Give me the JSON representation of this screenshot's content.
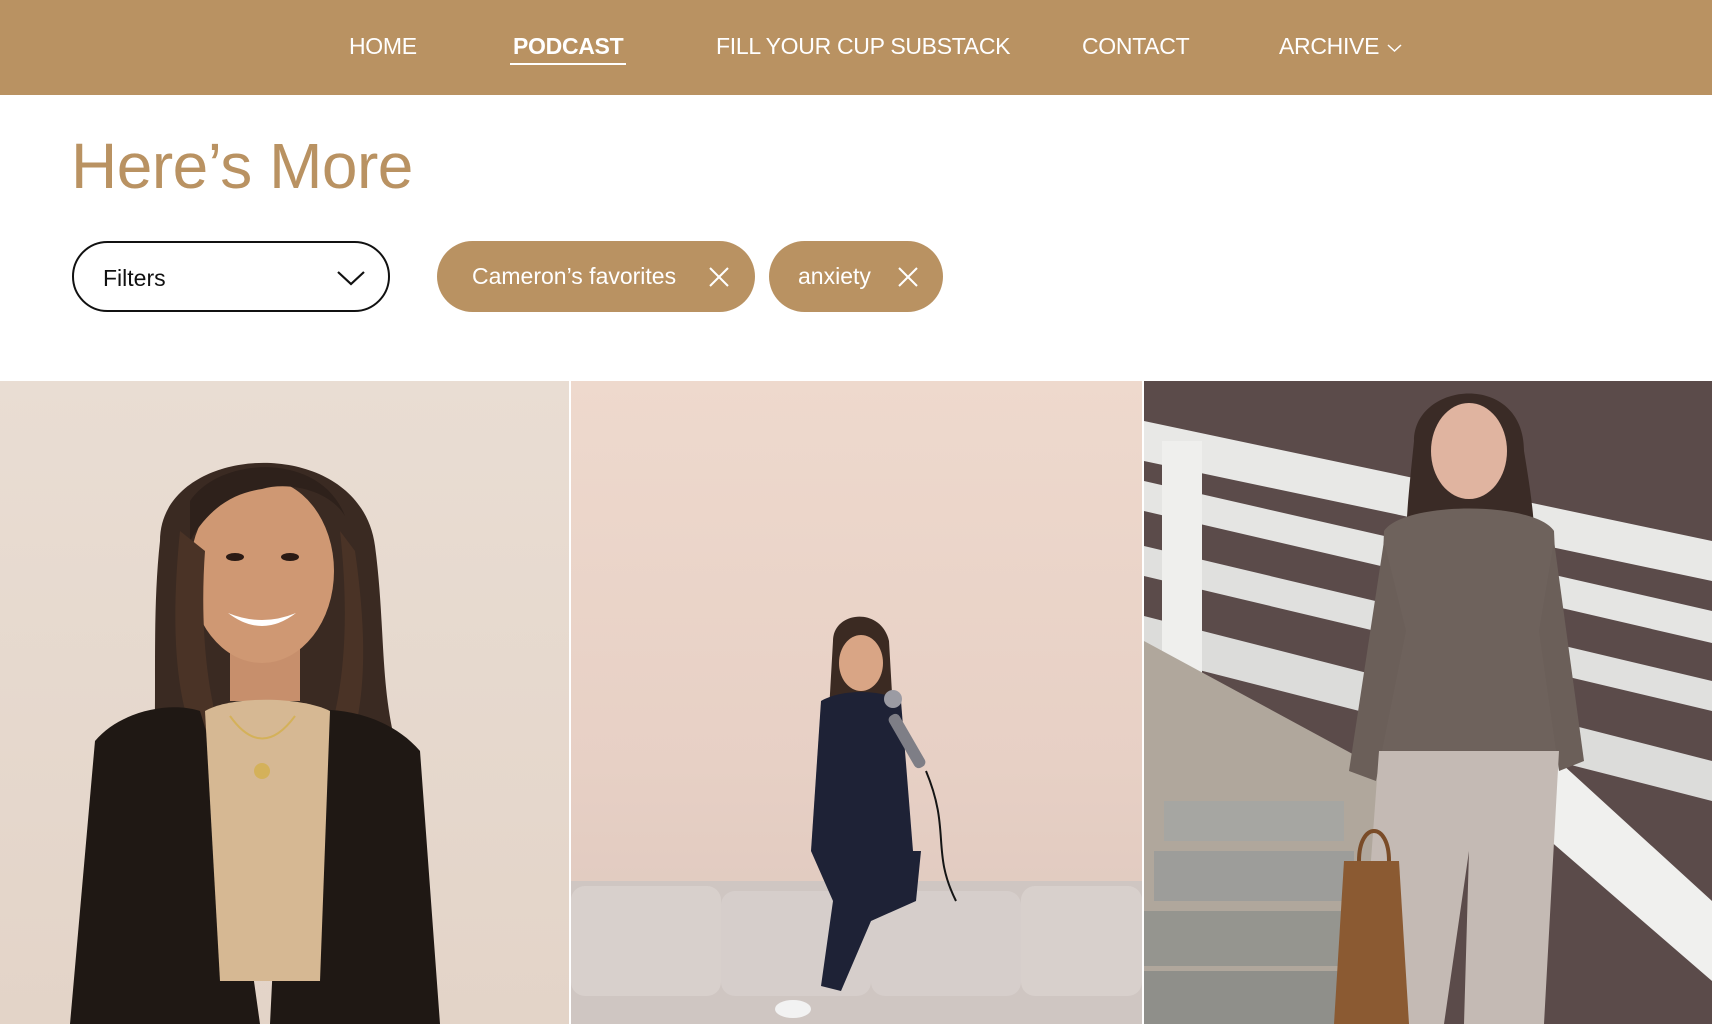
{
  "nav": {
    "home": "HOME",
    "podcast": "PODCAST",
    "substack": "FILL YOUR CUP SUBSTACK",
    "contact": "CONTACT",
    "archive": "ARCHIVE",
    "active": "PODCAST"
  },
  "page": {
    "title": "Here’s More"
  },
  "filters": {
    "select_label": "Filters",
    "chips": [
      {
        "label": "Cameron’s favorites"
      },
      {
        "label": "anxiety"
      }
    ]
  },
  "icons": {
    "archive_dropdown": "chevron-down-icon",
    "filters_dropdown": "chevron-down-icon",
    "chip_remove": "close-icon"
  },
  "colors": {
    "brand": "#b99262",
    "text_dark": "#111111",
    "white": "#ffffff"
  }
}
